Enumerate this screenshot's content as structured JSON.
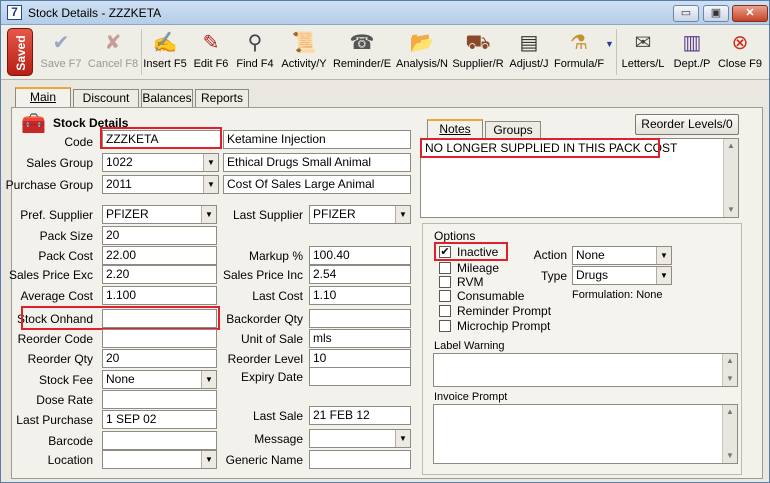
{
  "window": {
    "title": "Stock Details - ZZZKETA",
    "app_icon": "7",
    "buttons": {
      "minimize": "▭",
      "restore": "▣",
      "close": "✕"
    }
  },
  "saved": "Saved",
  "toolbar": [
    {
      "label": "Save F7",
      "icon": "save-check-icon",
      "enabled": false
    },
    {
      "label": "Cancel F8",
      "icon": "cancel-x-icon",
      "enabled": false
    },
    {
      "label": "Insert F5",
      "icon": "insert-pen-icon",
      "enabled": true
    },
    {
      "label": "Edit F6",
      "icon": "edit-pen-icon",
      "enabled": true
    },
    {
      "label": "Find F4",
      "icon": "magnifier-icon",
      "enabled": true
    },
    {
      "label": "Activity/Y",
      "icon": "activity-scroll-icon",
      "enabled": true
    },
    {
      "label": "Reminder/E",
      "icon": "reminder-icon",
      "enabled": true
    },
    {
      "label": "Analysis/N",
      "icon": "analysis-folder-icon",
      "enabled": true
    },
    {
      "label": "Supplier/R",
      "icon": "truck-icon",
      "enabled": true
    },
    {
      "label": "Adjust/J",
      "icon": "adjust-document-icon",
      "enabled": true
    },
    {
      "label": "Formula/F",
      "icon": "formula-icon",
      "enabled": true
    },
    {
      "label": "Letters/L",
      "icon": "letters-icon",
      "enabled": true
    },
    {
      "label": "Dept./P",
      "icon": "dept-chart-icon",
      "enabled": true
    },
    {
      "label": "Close F9",
      "icon": "close-circle-icon",
      "enabled": true
    }
  ],
  "tabs": {
    "main": "Main",
    "discount": "Discount",
    "balances": "Balances",
    "reports": "Reports"
  },
  "section_title": "Stock Details",
  "fields": {
    "code": {
      "label": "Code",
      "value": "ZZZKETA",
      "description": "Ketamine Injection"
    },
    "sales_group": {
      "label": "Sales Group",
      "value": "1022",
      "description": "Ethical Drugs Small Animal"
    },
    "purchase_group": {
      "label": "Purchase Group",
      "value": "2011",
      "description": "Cost Of Sales Large Animal"
    },
    "pref_supplier": {
      "label": "Pref. Supplier",
      "value": "PFIZER"
    },
    "last_supplier": {
      "label": "Last Supplier",
      "value": "PFIZER"
    },
    "pack_size": {
      "label": "Pack Size",
      "value": "20"
    },
    "pack_cost": {
      "label": "Pack Cost",
      "value": "22.00"
    },
    "markup": {
      "label": "Markup %",
      "value": "100.40"
    },
    "sales_price_exc": {
      "label": "Sales Price Exc",
      "value": "2.20"
    },
    "sales_price_inc": {
      "label": "Sales Price Inc",
      "value": "2.54"
    },
    "average_cost": {
      "label": "Average Cost",
      "value": "1.100"
    },
    "last_cost": {
      "label": "Last Cost",
      "value": "1.10"
    },
    "stock_onhand": {
      "label": "Stock Onhand",
      "value": ""
    },
    "backorder_qty": {
      "label": "Backorder Qty",
      "value": ""
    },
    "reorder_code": {
      "label": "Reorder Code",
      "value": ""
    },
    "unit_of_sale": {
      "label": "Unit of Sale",
      "value": "mls"
    },
    "reorder_qty": {
      "label": "Reorder Qty",
      "value": "20"
    },
    "reorder_level": {
      "label": "Reorder Level",
      "value": "10"
    },
    "stock_fee": {
      "label": "Stock Fee",
      "value": "None"
    },
    "expiry_date": {
      "label": "Expiry Date",
      "value": ""
    },
    "dose_rate": {
      "label": "Dose Rate",
      "value": ""
    },
    "last_purchase": {
      "label": "Last Purchase",
      "value": "1 SEP 02"
    },
    "last_sale": {
      "label": "Last Sale",
      "value": "21 FEB 12"
    },
    "barcode": {
      "label": "Barcode",
      "value": ""
    },
    "message": {
      "label": "Message",
      "value": ""
    },
    "location": {
      "label": "Location",
      "value": ""
    },
    "generic_name": {
      "label": "Generic Name",
      "value": ""
    }
  },
  "notes_tabs": {
    "notes": "Notes",
    "groups": "Groups"
  },
  "reorder_levels_button": "Reorder Levels/0",
  "notes_text": "NO LONGER SUPPLIED IN THIS PACK COST",
  "options": {
    "title": "Options",
    "inactive": {
      "label": "Inactive",
      "checked": true
    },
    "mileage": {
      "label": "Mileage",
      "checked": false
    },
    "rvm": {
      "label": "RVM",
      "checked": false
    },
    "consumable": {
      "label": "Consumable",
      "checked": false
    },
    "reminder_prompt": {
      "label": "Reminder Prompt",
      "checked": false
    },
    "microchip_prompt": {
      "label": "Microchip Prompt",
      "checked": false
    },
    "action": {
      "label": "Action",
      "value": "None"
    },
    "type": {
      "label": "Type",
      "value": "Drugs"
    },
    "formulation": "Formulation: None"
  },
  "label_warning": "Label Warning",
  "invoice_prompt": "Invoice Prompt",
  "colors": {
    "highlight": "#e0202a",
    "saved": "#c8291c",
    "active_tab": "#e8a83a"
  }
}
